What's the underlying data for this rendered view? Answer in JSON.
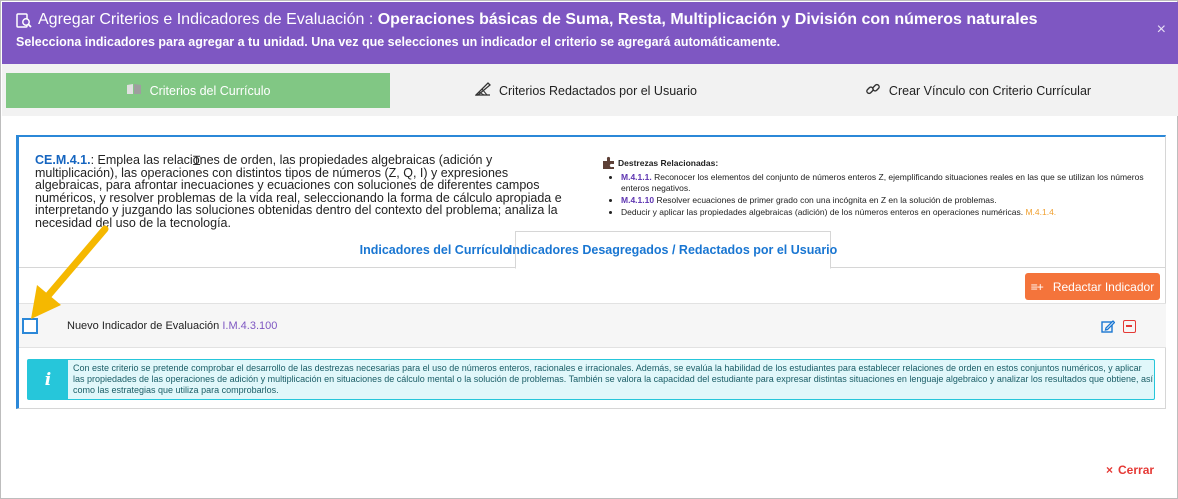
{
  "header": {
    "title_prefix": "Agregar Criterios e Indicadores de Evaluación : ",
    "title_bold": "Operaciones básicas de Suma, Resta, Multiplicación y División con números naturales",
    "subtitle": "Selecciona indicadores para agregar a tu unidad. Una vez que selecciones un indicador el criterio se agregará automáticamente.",
    "close_glyph": "×"
  },
  "tabs": [
    {
      "label": "Criterios del Currículo",
      "icon": "book-icon",
      "active": true
    },
    {
      "label": "Criterios Redactados por el Usuario",
      "icon": "edit-draw-icon",
      "active": false
    },
    {
      "label": "Crear Vínculo con Criterio Currícular",
      "icon": "link-icon",
      "active": false
    }
  ],
  "criterion": {
    "code": "CE.M.4.1.",
    "text": ": Emplea las relaciones de orden, las propiedades algebraicas (adición y multiplicación), las operaciones con distintos tipos de números (Z, Q, I) y expresiones algebraicas, para afrontar inecuaciones y ecuaciones con soluciones de diferentes campos numéricos, y resolver problemas de la vida real, seleccionando la forma de cálculo apropiada e interpretando y juzgando las soluciones obtenidas dentro del contexto del problema; analiza la necesidad del uso de la tecnología."
  },
  "destrezas": {
    "heading": "Destrezas Relacionadas:",
    "items": [
      {
        "code": "M.4.1.1.",
        "text": " Reconocer los elementos del conjunto de números enteros Z, ejemplificando situaciones reales en las que se utilizan los números enteros negativos.",
        "suffix": ""
      },
      {
        "code": "M.4.1.10",
        "text": " Resolver ecuaciones de primer grado con una incógnita en Z en la solución de problemas.",
        "suffix": ""
      },
      {
        "code": "",
        "text": "Deducir y aplicar las propiedades algebraicas (adición) de los números enteros en operaciones numéricas. ",
        "suffix": "M.4.1.4."
      }
    ]
  },
  "inner_tabs": [
    {
      "label": "Indicadores del Currículo",
      "active": false
    },
    {
      "label": "Indicadores Desagregados / Redactados por el Usuario",
      "active": true
    }
  ],
  "redactar_button": {
    "label": "Redactar Indicador",
    "icon_glyph": "≡+"
  },
  "indicator": {
    "label": "Nuevo Indicador de Evaluación ",
    "code": "I.M.4.3.100",
    "checked": false
  },
  "info": {
    "icon_glyph": "i",
    "text": "Con este criterio se pretende comprobar el desarrollo de las destrezas necesarias para el uso de números enteros, racionales e irracionales. Además, se evalúa la habilidad de los estudiantes para establecer relaciones de orden en estos conjuntos numéricos, y aplicar las propiedades de las operaciones de adición y multiplicación en situaciones de cálculo mental o la solución de problemas. También se valora la capacidad del estudiante para expresar distintas situaciones en lenguaje algebraico y analizar los resultados que obtiene, así como las estrategias que utiliza para comprobarlos."
  },
  "footer": {
    "close_label": "Cerrar",
    "close_glyph": "×"
  },
  "colors": {
    "header": "#7e57c2",
    "active_tab": "#81c784",
    "accent_blue": "#2b88d8",
    "button_orange": "#f4743b",
    "info_cyan": "#26c6da",
    "danger": "#e53935",
    "annotation_arrow": "#f5b800"
  }
}
